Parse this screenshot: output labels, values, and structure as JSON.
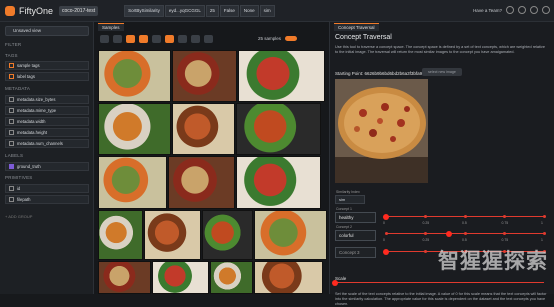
{
  "app": {
    "brand": "FiftyOne",
    "dataset": "coco-2017-test"
  },
  "topbar": {
    "chips": [
      "SortBySimilarity",
      "eyd...yqGCGGL",
      "25",
      "False",
      "None",
      "sim"
    ],
    "help": "Have a Team?"
  },
  "sidebar": {
    "view": "Unsaved view",
    "filter": "FILTER",
    "tags_section": "TAGS",
    "tags": [
      "sample tags",
      "label tags"
    ],
    "metadata_section": "METADATA",
    "metadata": [
      "metadata.size_bytes",
      "metadata.mime_type",
      "metadata.width",
      "metadata.height",
      "metadata.num_channels"
    ],
    "labels_section": "LABELS",
    "labels": [
      "ground_truth"
    ],
    "primitives_section": "PRIMITIVES",
    "primitives": [
      "id",
      "filepath"
    ],
    "add_group": "+ ADD GROUP"
  },
  "samples": {
    "tab": "Samples",
    "count": "25 samples"
  },
  "panel": {
    "tab": "Concept Traversal",
    "title": "Concept Traversal",
    "description": "Use this tool to traverse a concept space. The concept space is defined by a set of text concepts, which are weighted relative to the initial image. The traversal will return the most similar images to the concept you have amalgamated.",
    "start_label": "Starting Point:",
    "start_id": "6626b9b6bd6bd2b6a3f3bfa9",
    "select_btn": "select new image",
    "sim_index_label": "Similarity Index",
    "sim_index_value": "sim",
    "concepts": [
      {
        "label": "Concept 1",
        "value": "healthy",
        "weight": 0.0
      },
      {
        "label": "Concept 2",
        "value": "colorful",
        "weight": 0.4
      },
      {
        "label": "Concept 3",
        "value": "Concept 3",
        "weight": 0.0
      }
    ],
    "ticks": [
      "0",
      "0.25",
      "0.5",
      "0.75",
      "1"
    ],
    "scale_label": "Scale",
    "scale_value": 0.0,
    "footer": "Set the scale of the text concepts relative to the initial image. A value of 0 for this scale means that the text concepts will factor into the similarity calculation. The appropriate value for this scale is dependent on the dataset and the text concepts you have chosen."
  },
  "watermark": "智猩猩探索",
  "colors": {
    "accent": "#f07b2a",
    "slider": "#e03a2e"
  }
}
